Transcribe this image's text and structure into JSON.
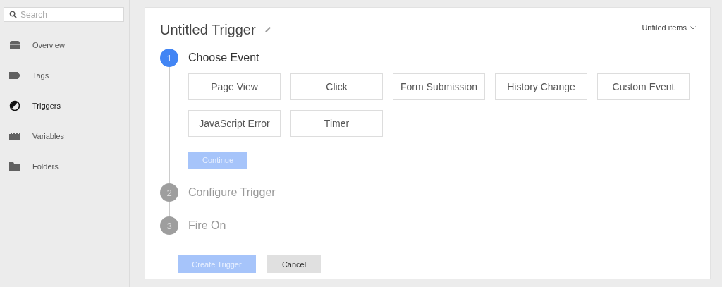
{
  "sidebar": {
    "search": {
      "placeholder": "Search"
    },
    "items": [
      {
        "label": "Overview",
        "kind": "overview",
        "selected": false
      },
      {
        "label": "Tags",
        "kind": "tag",
        "selected": false
      },
      {
        "label": "Triggers",
        "kind": "trigger",
        "selected": true
      },
      {
        "label": "Variables",
        "kind": "variable",
        "selected": false
      },
      {
        "label": "Folders",
        "kind": "folder",
        "selected": false
      }
    ]
  },
  "editor": {
    "title": "Untitled Trigger",
    "folder": "Unfiled items",
    "steps": [
      {
        "number": "1",
        "label": "Choose Event",
        "selected": true,
        "events": [
          "Page View",
          "Click",
          "Form Submission",
          "History Change",
          "Custom Event",
          "JavaScript Error",
          "Timer"
        ],
        "continue": {
          "label": "Continue",
          "disabled": true
        }
      },
      {
        "number": "2",
        "label": "Configure Trigger",
        "selected": false
      },
      {
        "number": "3",
        "label": "Fire On",
        "selected": false
      }
    ],
    "buttons": [
      {
        "label": "Create Trigger",
        "kind": "primary",
        "disabled": true
      },
      {
        "label": "Cancel",
        "kind": "secondary",
        "disabled": false
      }
    ]
  }
}
